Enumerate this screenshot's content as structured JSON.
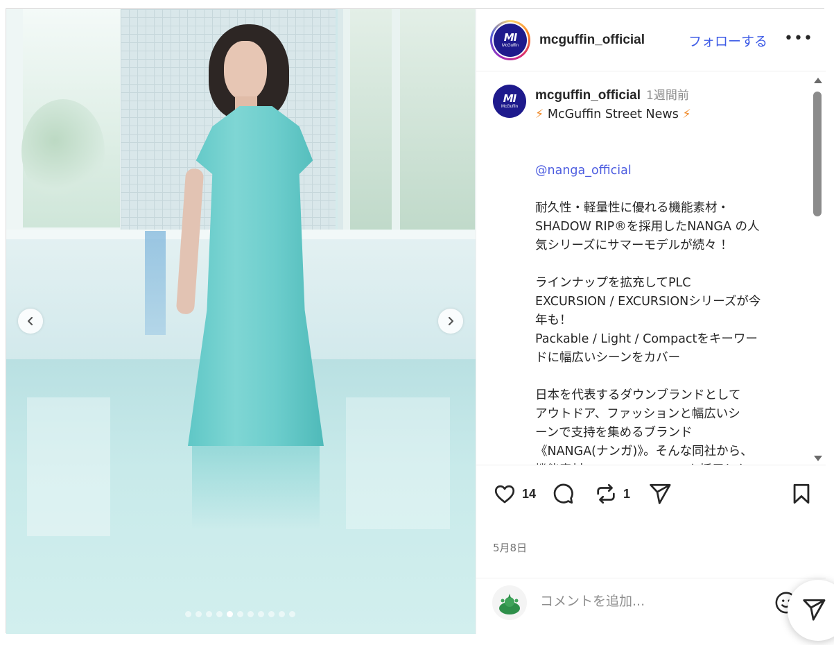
{
  "post": {
    "username": "mcguffin_official",
    "follow_label": "フォローする",
    "more_label": "•••",
    "logo_mark": "MI",
    "logo_word": "McGuffin"
  },
  "caption": {
    "username": "mcguffin_official",
    "time": "1週間前",
    "bolt": "⚡",
    "headline": "McGuffin Street News",
    "mention": "@nanga_official",
    "paragraphs": [
      "耐久性・軽量性に優れる機能素材・\nSHADOW RIP®を採用したNANGA の人\n気シリーズにサマーモデルが続々 ！",
      "ラインナップを拡充してPLC\nEXCURSION / EXCURSIONシリーズが今\n年も！\nPackable / Light / Compactをキーワー\nドに幅広いシーンをカバー",
      "日本を代表するダウンブランドとして\nアウトドア、ファッションと幅広いシ\nーンで支持を集めるブランド\n《NANGA(ナンガ)》。そんな同社から、\n機能素材“SHADOW RIP®”を採用した\nPLC EXCURSIONシリーズ / EXCURSION"
    ]
  },
  "actions": {
    "like_count": "14",
    "repost_count": "1"
  },
  "date": "5月8日",
  "comment": {
    "placeholder": "コメントを追加..."
  },
  "carousel": {
    "total_images": 11,
    "active_index": 4
  },
  "colors": {
    "follow": "#3d5be6",
    "mention": "#4d5de0",
    "brand_logo": "#1e1a8c",
    "dress": "#6ccdcc"
  },
  "icons": [
    "heart-icon",
    "comment-icon",
    "repost-icon",
    "share-icon",
    "bookmark-icon",
    "emoji-icon",
    "chevron-left-icon",
    "chevron-right-icon"
  ]
}
